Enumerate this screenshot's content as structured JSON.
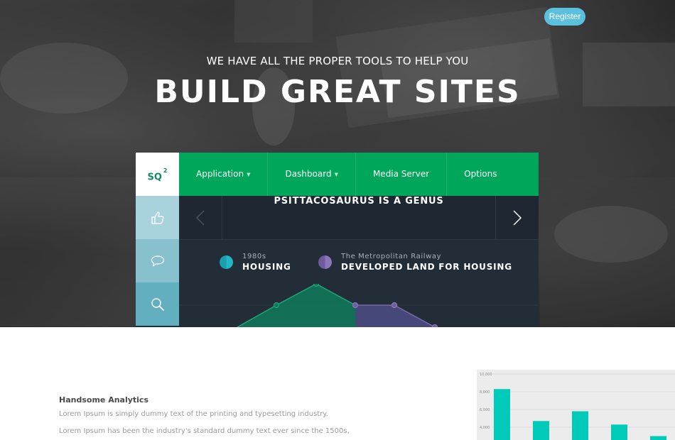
{
  "header": {
    "register_label": "Register"
  },
  "hero": {
    "kicker": "WE HAVE ALL THE PROPER TOOLS TO HELP YOU",
    "title": "BUILD GREAT SITES"
  },
  "app": {
    "logo": "SQ",
    "logo_sup": "2",
    "nav": [
      {
        "label": "Application",
        "has_caret": true
      },
      {
        "label": "Dashboard",
        "has_caret": true
      },
      {
        "label": "Media Server",
        "has_caret": false
      },
      {
        "label": "Options",
        "has_caret": false
      }
    ],
    "sidebar_icons": [
      "thumbs-up-icon",
      "speech-bubble-icon",
      "search-icon"
    ],
    "slider_title": "PSITTACOSAURUS IS A GENUS",
    "legend": [
      {
        "small": "1980s",
        "big": "HOUSING",
        "color": "#1fb0c0"
      },
      {
        "small": "The Metropolitan Railway",
        "big": "DEVELOPED LAND FOR HOUSING",
        "color": "#7b68aa"
      }
    ],
    "colors": {
      "nav_green": "#00a65a",
      "panel_dark": "#232d37",
      "series_green": "#1fa77a",
      "series_purple": "#6d5da8"
    }
  },
  "features": {
    "title": "Handsome Analytics",
    "line1": "Lorem Ipsum is simply dummy text of the printing and typesetting industry.",
    "line2": "Lorem Ipsum has been the industry's standard dummy text ever since the 1500s,"
  },
  "chart_data": {
    "type": "bar",
    "y_ticks": [
      "10,000",
      "8,000",
      "6,000",
      "4,000"
    ],
    "values": [
      8300,
      4700,
      5800,
      4300,
      3000
    ],
    "ylim": [
      2000,
      10000
    ],
    "color": "#00cbb8"
  }
}
